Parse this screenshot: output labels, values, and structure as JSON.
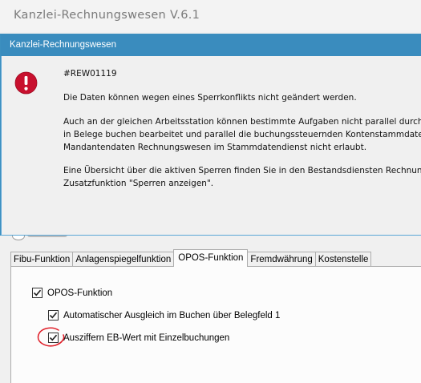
{
  "app": {
    "title": "Kanzlei-Rechnungswesen V.6.1"
  },
  "dialog": {
    "title": "Kanzlei-Rechnungswesen",
    "code": "#REW01119",
    "message": "Die Daten können wegen eines Sperrkonflikts nicht geändert werden.",
    "detail_lines": [
      "Auch an der gleichen Arbeitsstation können bestimmte Aufgaben nicht parallel durch",
      "in Belege buchen bearbeitet und parallel die buchungssteuernden Kontenstammdate",
      "Mandantendaten Rechnungswesen im Stammdatendienst nicht erlaubt."
    ],
    "hint_lines": [
      "Eine Übersicht über die aktiven Sperren finden Sie in den Bestandsdiensten Rechnung",
      "Zusatzfunktion \"Sperren anzeigen\"."
    ]
  },
  "tabs": [
    {
      "label": "Fibu-Funktion",
      "active": false
    },
    {
      "label": "Anlagenspiegelfunktion",
      "active": false
    },
    {
      "label": "OPOS-Funktion",
      "active": true
    },
    {
      "label": "Fremdwährung",
      "active": false
    },
    {
      "label": "Kostenstelle",
      "active": false
    }
  ],
  "options": {
    "opos": {
      "label": "OPOS-Funktion",
      "checked": true
    },
    "auto_ausgleich": {
      "label": "Automatischer Ausgleich im Buchen über Belegfeld 1",
      "checked": true
    },
    "eb_wert": {
      "label": "Ausziffern EB-Wert mit Einzelbuchungen",
      "checked": true
    }
  },
  "colors": {
    "dialog_titlebar": "#3a8cbe",
    "error_icon": "#c8102e",
    "annotation": "#e0202a"
  },
  "icons": {
    "error": "error-icon",
    "check": "checkmark-icon"
  }
}
